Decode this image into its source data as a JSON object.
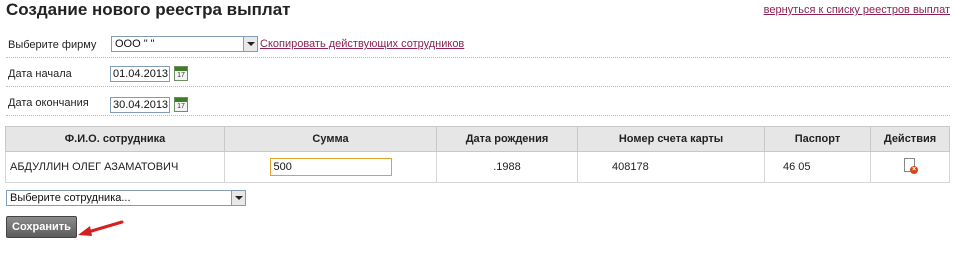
{
  "page": {
    "title": "Создание нового реестра выплат",
    "back_link": "вернуться к списку реестров выплат"
  },
  "form": {
    "firm_label": "Выберите фирму",
    "firm_value": "ООО \"                    \"",
    "copy_employees_link": "Скопировать действующих сотрудников",
    "start_label": "Дата начала",
    "start_value": "01.04.2013",
    "end_label": "Дата окончания",
    "end_value": "30.04.2013",
    "calendar_day": "17"
  },
  "table": {
    "headers": [
      "Ф.И.О. сотрудника",
      "Сумма",
      "Дата рождения",
      "Номер счета карты",
      "Паспорт",
      "Действия"
    ],
    "rows": [
      {
        "name": "АБДУЛЛИН ОЛЕГ АЗАМАТОВИЧ",
        "amount": "500",
        "birth_date": ".1988",
        "card_number": "408178",
        "passport": "46 05"
      }
    ]
  },
  "employee_select": {
    "placeholder": "Выберите сотрудника..."
  },
  "save_button": "Сохранить",
  "colors": {
    "link": "#8b2252",
    "header_bg": "#e6e6e6",
    "save_button": "#6c6c6c",
    "annotation_arrow": "#d42020"
  }
}
